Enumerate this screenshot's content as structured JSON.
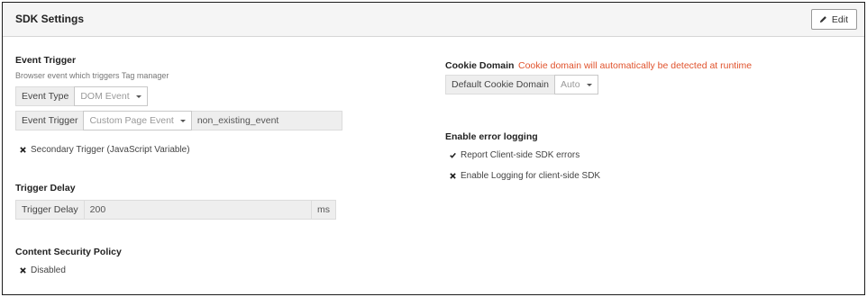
{
  "header": {
    "title": "SDK Settings",
    "edit_label": "Edit"
  },
  "event_trigger": {
    "title": "Event Trigger",
    "help": "Browser event which triggers Tag manager",
    "type_label": "Event Type",
    "type_value": "DOM Event",
    "trigger_label": "Event Trigger",
    "trigger_select": "Custom Page Event",
    "trigger_value": "non_existing_event",
    "secondary_label": "Secondary Trigger (JavaScript Variable)"
  },
  "trigger_delay": {
    "title": "Trigger Delay",
    "label": "Trigger Delay",
    "value": "200",
    "unit": "ms"
  },
  "csp": {
    "title": "Content Security Policy",
    "status": "Disabled"
  },
  "cookie_domain": {
    "title": "Cookie Domain",
    "warning": "Cookie domain will automatically be detected at runtime",
    "label": "Default Cookie Domain",
    "value": "Auto"
  },
  "error_logging": {
    "title": "Enable error logging",
    "items": [
      {
        "label": "Report Client-side SDK errors",
        "state": "check-icon"
      },
      {
        "label": "Enable Logging for client-side SDK",
        "state": "cross-icon"
      }
    ]
  },
  "colors": {
    "warning": "#e0522c",
    "header_bg": "#f5f5f5",
    "addon_bg": "#eeeeee"
  }
}
